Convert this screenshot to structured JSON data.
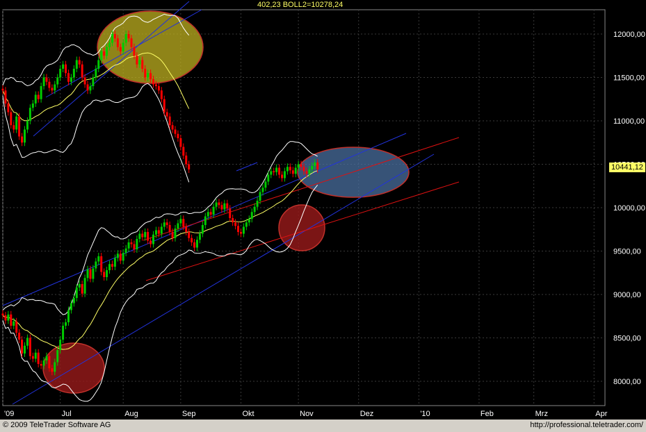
{
  "header": {
    "text": "402,23 BOLL2=10278,24"
  },
  "footer": {
    "copyright": "© 2009 TeleTrader Software AG",
    "url": "http://professional.teletrader.com/"
  },
  "current_price_label": "10441,12",
  "colors": {
    "background": "#000000",
    "grid": "#3a3a3a",
    "axis_text": "#ffffff",
    "candle_up": "#00cc00",
    "candle_down": "#ff0000",
    "bollinger_band": "#ffffff",
    "moving_average": "#ffff66",
    "trend_channel_blue": "#2233dd",
    "trend_channel_red": "#dd1111",
    "highlight_yellow": "#bfb020",
    "highlight_blue": "#4a6f9f",
    "highlight_red": "#9a1a1a"
  },
  "chart_data": {
    "type": "candlestick",
    "y_axis": {
      "position": "right",
      "range": [
        7720,
        12280
      ],
      "ticks": [
        "12000,00",
        "11500,00",
        "11000,00",
        "10500,00",
        "10000,00",
        "9500,00",
        "9000,00",
        "8500,00",
        "8000,00"
      ],
      "tick_values": [
        12000,
        11500,
        11000,
        10500,
        10000,
        9500,
        9000,
        8500,
        8000
      ]
    },
    "x_axis": {
      "ticks": [
        "'09",
        "Jul",
        "Aug",
        "Sep",
        "Okt",
        "Nov",
        "Dez",
        "'10",
        "Feb",
        "Mrz",
        "Apr"
      ],
      "tick_index": [
        0,
        21,
        44,
        65,
        87,
        108,
        130,
        152,
        174,
        194,
        216
      ]
    },
    "grid": true,
    "series": [
      {
        "kind": "close_path_2009",
        "closes": [
          8760,
          8700,
          8770,
          8640,
          8690,
          8560,
          8480,
          8320,
          8410,
          8500,
          8290,
          8260,
          8330,
          8200,
          8180,
          8240,
          8290,
          8150,
          8110,
          8220,
          8360,
          8480,
          8640,
          8680,
          8820,
          8900,
          8960,
          9080,
          9120,
          9010,
          9190,
          9290,
          9180,
          9300,
          9380,
          9440,
          9260,
          9200,
          9280,
          9350,
          9320,
          9420,
          9470,
          9390,
          9480,
          9530,
          9600,
          9580,
          9520,
          9640,
          9700,
          9660,
          9720,
          9620,
          9580,
          9690,
          9740,
          9700,
          9780,
          9830,
          9800,
          9720,
          9650,
          9760,
          9820,
          9870,
          9780,
          9720,
          9650,
          9600,
          9540,
          9630,
          9700,
          9800,
          9900,
          9950,
          9920,
          10010,
          10060,
          10030,
          9980,
          10050,
          9990,
          9880,
          9830,
          9790,
          9720,
          9700,
          9780,
          9830,
          9870,
          9950,
          10010,
          10080,
          10180,
          10230,
          10300,
          10380,
          10420,
          10410,
          10460,
          10380,
          10340,
          10420,
          10470,
          10430,
          10390,
          10460,
          10500,
          10470,
          10420,
          10390,
          10440,
          10480,
          10520,
          10441
        ]
      },
      {
        "kind": "close_path_2008_shifted",
        "closes": [
          11350,
          11200,
          11100,
          10950,
          10900,
          11050,
          10820,
          10750,
          10900,
          11000,
          11150,
          11200,
          11300,
          11250,
          11400,
          11500,
          11450,
          11380,
          11350,
          11420,
          11500,
          11600,
          11650,
          11550,
          11450,
          11500,
          11600,
          11700,
          11650,
          11500,
          11420,
          11350,
          11400,
          11500,
          11600,
          11700,
          11800,
          11750,
          11850,
          11900,
          12000,
          11950,
          11850,
          11800,
          11900,
          12000,
          11950,
          11850,
          11750,
          11650,
          11700,
          11600,
          11500,
          11550,
          11480,
          11420,
          11400,
          11350,
          11250,
          11100,
          11050,
          10950,
          10900,
          10850,
          10800,
          10700,
          10600,
          10500,
          10440
        ]
      }
    ],
    "annotations": [
      {
        "type": "ellipse",
        "color": "highlight_yellow",
        "label": ""
      },
      {
        "type": "ellipse",
        "color": "highlight_blue",
        "label": ""
      },
      {
        "type": "ellipse",
        "color": "highlight_red",
        "label": ""
      },
      {
        "type": "ellipse",
        "color": "highlight_red",
        "label": ""
      }
    ]
  }
}
